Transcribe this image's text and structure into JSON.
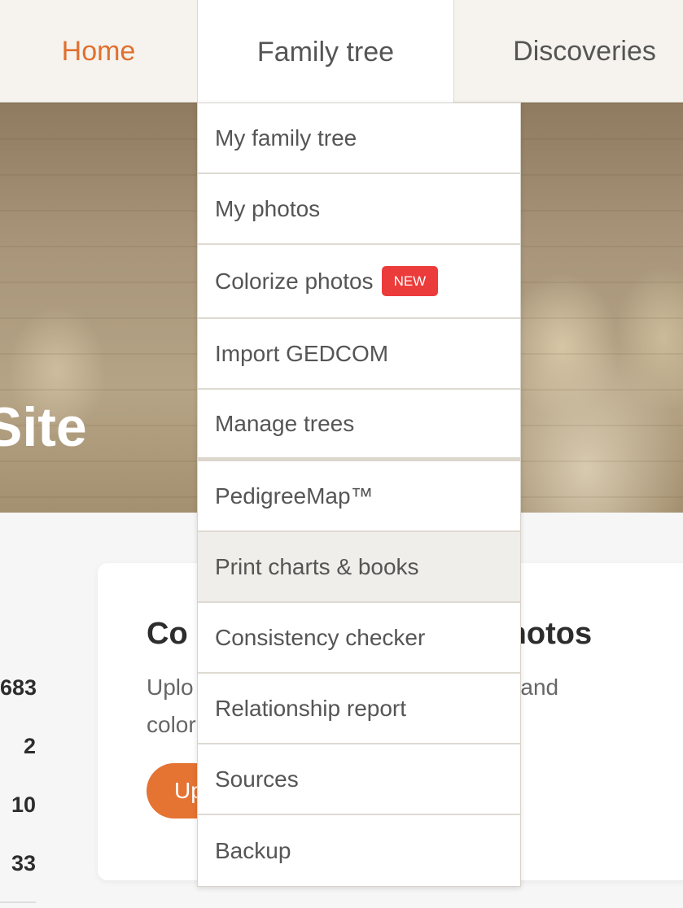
{
  "nav": {
    "tabs": [
      {
        "label": "Home",
        "state": "active"
      },
      {
        "label": "Family tree",
        "state": "open"
      },
      {
        "label": "Discoveries",
        "state": "default"
      }
    ]
  },
  "hero": {
    "title_fragment": "Site"
  },
  "dropdown": {
    "items": [
      {
        "label": "My family tree"
      },
      {
        "label": "My photos"
      },
      {
        "label": "Colorize photos",
        "badge": "NEW"
      },
      {
        "label": "Import GEDCOM"
      },
      {
        "label": "Manage trees"
      },
      {
        "label": "PedigreeMap™"
      },
      {
        "label": "Print charts & books",
        "state": "hover"
      },
      {
        "label": "Consistency checker"
      },
      {
        "label": "Relationship report"
      },
      {
        "label": "Sources"
      },
      {
        "label": "Backup"
      }
    ]
  },
  "stats": {
    "values": [
      "683",
      "2",
      "10",
      "33"
    ]
  },
  "card": {
    "title_left": "Co",
    "title_right": "hotos",
    "desc_line1_left": "Uplo",
    "desc_line1_right": "s and",
    "desc_line2_left": "color",
    "button_label_fragment": "Up"
  },
  "colors": {
    "accent": "#e57332",
    "badge_red": "#ec3b3b",
    "nav_bg": "#f6f3ee"
  }
}
